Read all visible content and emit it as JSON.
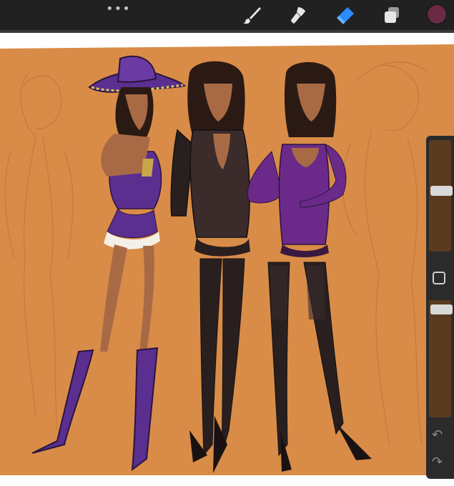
{
  "toolbar": {
    "more_glyph": "•••",
    "tools": [
      {
        "name": "brush-tool",
        "icon": "brush-icon",
        "active": false
      },
      {
        "name": "smudge-tool",
        "icon": "smudge-icon",
        "active": false
      },
      {
        "name": "eraser-tool",
        "icon": "eraser-icon",
        "active": true
      },
      {
        "name": "layers-tool",
        "icon": "layers-icon",
        "active": false
      }
    ],
    "current_color": "#6a2a45"
  },
  "colors": {
    "canvas_background": "#d98c48",
    "accent": "#2d8cff",
    "sidebar": "#2b2b2b"
  },
  "sidebar": {
    "brush_size_level": 0.55,
    "brush_opacity_level": 0.96,
    "undo_icon": "undo-icon",
    "redo_icon": "redo-icon",
    "undo_glyph": "↶",
    "redo_glyph": "↷"
  }
}
